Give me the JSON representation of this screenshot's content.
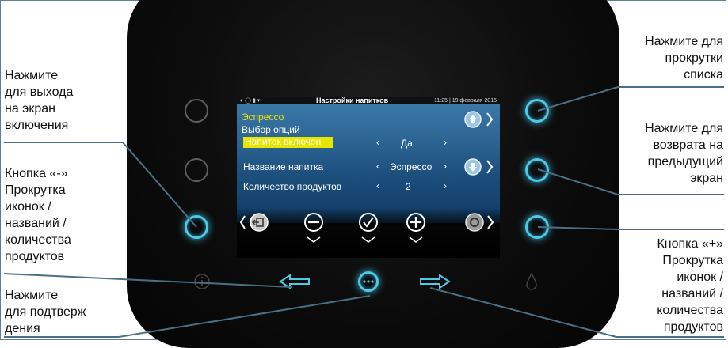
{
  "screen": {
    "title": "Настройки напитков",
    "status_time": "11:25 | 19 февраля 2015",
    "drink_name": "Эспрессо",
    "options_label": "Выбор опций",
    "rows": [
      {
        "label": "Напиток включен",
        "value": "Да"
      },
      {
        "label": "Название напитка",
        "value": "Эспрессо"
      },
      {
        "label": "Количество продуктов",
        "value": "2"
      }
    ]
  },
  "annotations": {
    "left_exit": "Нажмите\nдля выхода\nна экран\nвключения",
    "left_minus": "Кнопка «-»\nПрокрутка\nиконок /\nназваний /\nколичества\nпродуктов",
    "left_confirm": "Нажмите\nдля подтверж\nдения",
    "right_scroll": "Нажмите для\nпрокрутки\nсписка",
    "right_back": "Нажмите для\nвозврата на\nпредыдущий\nэкран",
    "right_plus": "Кнопка «+»\nПрокрутка\nиконок /\nназваний /\nколичества\nпродуктов"
  },
  "icons": {
    "left_buttons": [
      "circle-button",
      "circle-button",
      "minus-button"
    ],
    "right_buttons": [
      "scroll-button",
      "back-button",
      "plus-button"
    ],
    "bottom_row": [
      "info-icon",
      "arrow-left-icon",
      "menu-dots-icon",
      "arrow-right-icon",
      "water-drop-icon"
    ],
    "screen_row": [
      "exit-icon",
      "minus-circle-icon",
      "check-circle-icon",
      "plus-circle-icon",
      "settings-icon"
    ]
  },
  "colors": {
    "accent": "#4fc9e6",
    "highlight": "#e6e600",
    "screen_blue": "#2c6594",
    "device": "#0c0c0c"
  }
}
